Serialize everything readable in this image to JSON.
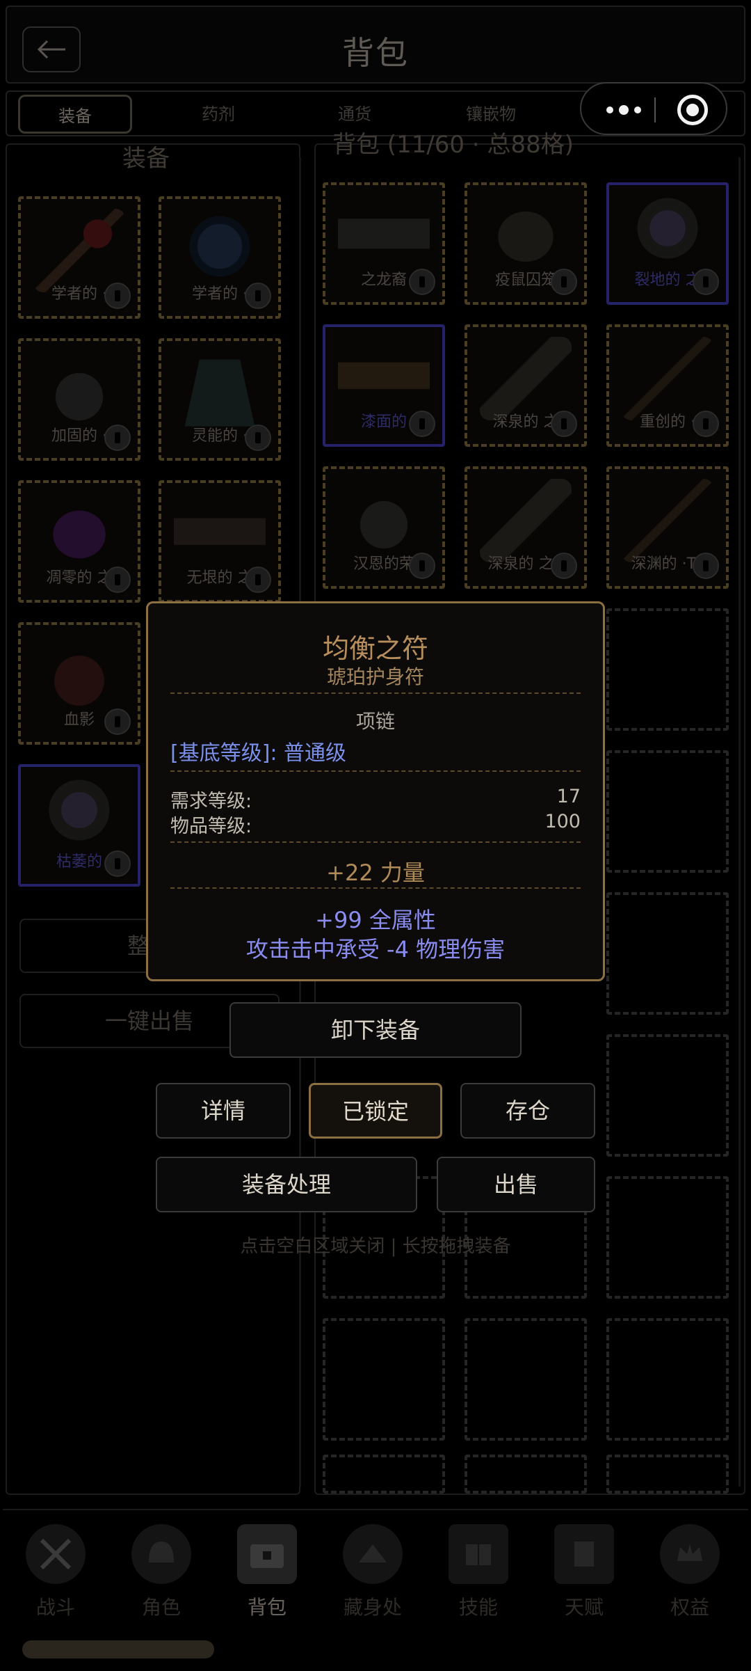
{
  "header": {
    "title": "背包",
    "back_icon": "arrow-left-icon"
  },
  "tabs": [
    {
      "label": "装备",
      "active": true
    },
    {
      "label": "药剂",
      "active": false
    },
    {
      "label": "通货",
      "active": false
    },
    {
      "label": "镶嵌物",
      "active": false
    }
  ],
  "capsule": {
    "more_icon": "more-dots-icon",
    "close_icon": "target-circle-icon"
  },
  "equip": {
    "title": "装备",
    "slots": [
      {
        "name": "学者的 ·",
        "rarity": "normal"
      },
      {
        "name": "学者的 ·",
        "rarity": "normal"
      },
      {
        "name": "加固的 ·",
        "rarity": "normal"
      },
      {
        "name": "灵能的 ·",
        "rarity": "normal"
      },
      {
        "name": "凋零的 之",
        "rarity": "normal"
      },
      {
        "name": "无垠的 之",
        "rarity": "normal"
      },
      {
        "name": "血影",
        "rarity": "normal"
      },
      {
        "name": "枯萎的",
        "rarity": "magic"
      }
    ],
    "sort_label": "整理",
    "sell_all_label": "一键出售"
  },
  "bag": {
    "title": "背包 (11/60 · 总88格)",
    "items": [
      {
        "name": "之龙裔",
        "rarity": "normal"
      },
      {
        "name": "疫鼠囚笼",
        "rarity": "normal"
      },
      {
        "name": "裂地的 之",
        "rarity": "magic"
      },
      {
        "name": "漆面的",
        "rarity": "magic"
      },
      {
        "name": "深泉的 之",
        "rarity": "normal"
      },
      {
        "name": "重创的 ·",
        "rarity": "normal"
      },
      {
        "name": "汉恩的荣",
        "rarity": "normal"
      },
      {
        "name": "深泉的 之..",
        "rarity": "normal"
      },
      {
        "name": "深渊的 ·T..",
        "rarity": "normal"
      }
    ]
  },
  "tooltip": {
    "name": "均衡之符",
    "base_type": "琥珀护身符",
    "item_class": "项链",
    "base_grade": "[基底等级]: 普通级",
    "req_level_label": "需求等级:",
    "req_level_value": "17",
    "item_level_label": "物品等级:",
    "item_level_value": "100",
    "implicit": "+22 力量",
    "mods": [
      "+99 全属性",
      "攻击击中承受 -4 物理伤害"
    ],
    "colors": {
      "border": "#8c7042",
      "name": "#b88f5c",
      "magic": "#8a8cf0",
      "base_grade": "#7a90ea"
    }
  },
  "actions": {
    "unequip": "卸下装备",
    "details": "详情",
    "locked": "已锁定",
    "stash": "存仓",
    "process": "装备处理",
    "sell": "出售",
    "hint": "点击空白区域关闭 | 长按拖拽装备"
  },
  "nav": [
    {
      "label": "战斗",
      "icon": "crossed-swords-icon",
      "active": false
    },
    {
      "label": "角色",
      "icon": "helmet-icon",
      "active": false
    },
    {
      "label": "背包",
      "icon": "chest-icon",
      "active": true
    },
    {
      "label": "藏身处",
      "icon": "hideout-icon",
      "active": false
    },
    {
      "label": "技能",
      "icon": "book-icon",
      "active": false
    },
    {
      "label": "天赋",
      "icon": "cards-icon",
      "active": false
    },
    {
      "label": "权益",
      "icon": "crown-icon",
      "active": false
    }
  ]
}
